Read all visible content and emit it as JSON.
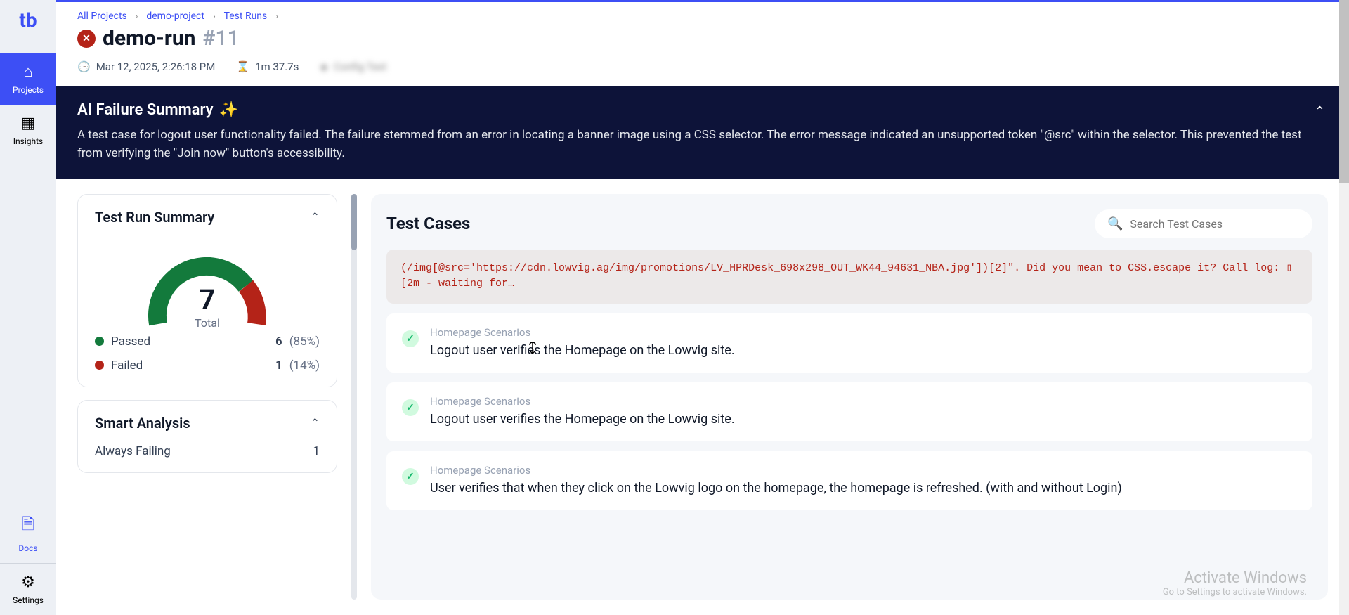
{
  "sidebar": {
    "logo": "tb",
    "items": [
      {
        "icon": "⌂",
        "label": "Projects"
      },
      {
        "icon": "▦",
        "label": "Insights"
      }
    ],
    "bottom": [
      {
        "icon": "🗎",
        "label": "Docs"
      },
      {
        "icon": "⚙",
        "label": "Settings"
      }
    ]
  },
  "breadcrumb": {
    "items": [
      "All Projects",
      "demo-project",
      "Test Runs"
    ]
  },
  "run": {
    "title": "demo-run",
    "number": "#11",
    "timestamp": "Mar 12, 2025, 2:26:18 PM",
    "duration": "1m 37.7s",
    "blurred": "Config Text"
  },
  "ai": {
    "title": "AI Failure Summary",
    "body": "A test case for logout user functionality failed. The failure stemmed from an error in locating a banner image using a CSS selector. The error message indicated an unsupported token \"@src\" within the selector. This prevented the test from verifying the \"Join now\" button's accessibility."
  },
  "summary": {
    "title": "Test Run Summary",
    "total": "7",
    "total_label": "Total",
    "passed_label": "Passed",
    "passed_count": "6",
    "passed_pct": "(85%)",
    "failed_label": "Failed",
    "failed_count": "1",
    "failed_pct": "(14%)"
  },
  "smart": {
    "title": "Smart Analysis",
    "rows": [
      {
        "label": "Always Failing",
        "value": "1"
      }
    ]
  },
  "testcases": {
    "title": "Test Cases",
    "search_placeholder": "Search Test Cases",
    "error_text": "(/img[@src='https://cdn.lowvig.ag/img/promotions/LV_HPRDesk_698x298_OUT_WK44_94631_NBA.jpg'])[2]\". Did you mean to CSS.escape it? Call log: ▯[2m - waiting for…",
    "items": [
      {
        "category": "Homepage Scenarios",
        "title": "Logout user verifies the Homepage on the Lowvig site."
      },
      {
        "category": "Homepage Scenarios",
        "title": "Logout user verifies the Homepage on the Lowvig site."
      },
      {
        "category": "Homepage Scenarios",
        "title": "User verifies that when they click on the Lowvig logo on the homepage, the homepage is refreshed. (with and without Login)"
      }
    ]
  },
  "watermark": {
    "title": "Activate Windows",
    "sub": "Go to Settings to activate Windows."
  },
  "chart_data": {
    "type": "gauge",
    "total": 7,
    "series": [
      {
        "name": "Passed",
        "value": 6,
        "pct": 85,
        "color": "#137a3c"
      },
      {
        "name": "Failed",
        "value": 1,
        "pct": 14,
        "color": "#b42318"
      }
    ]
  }
}
